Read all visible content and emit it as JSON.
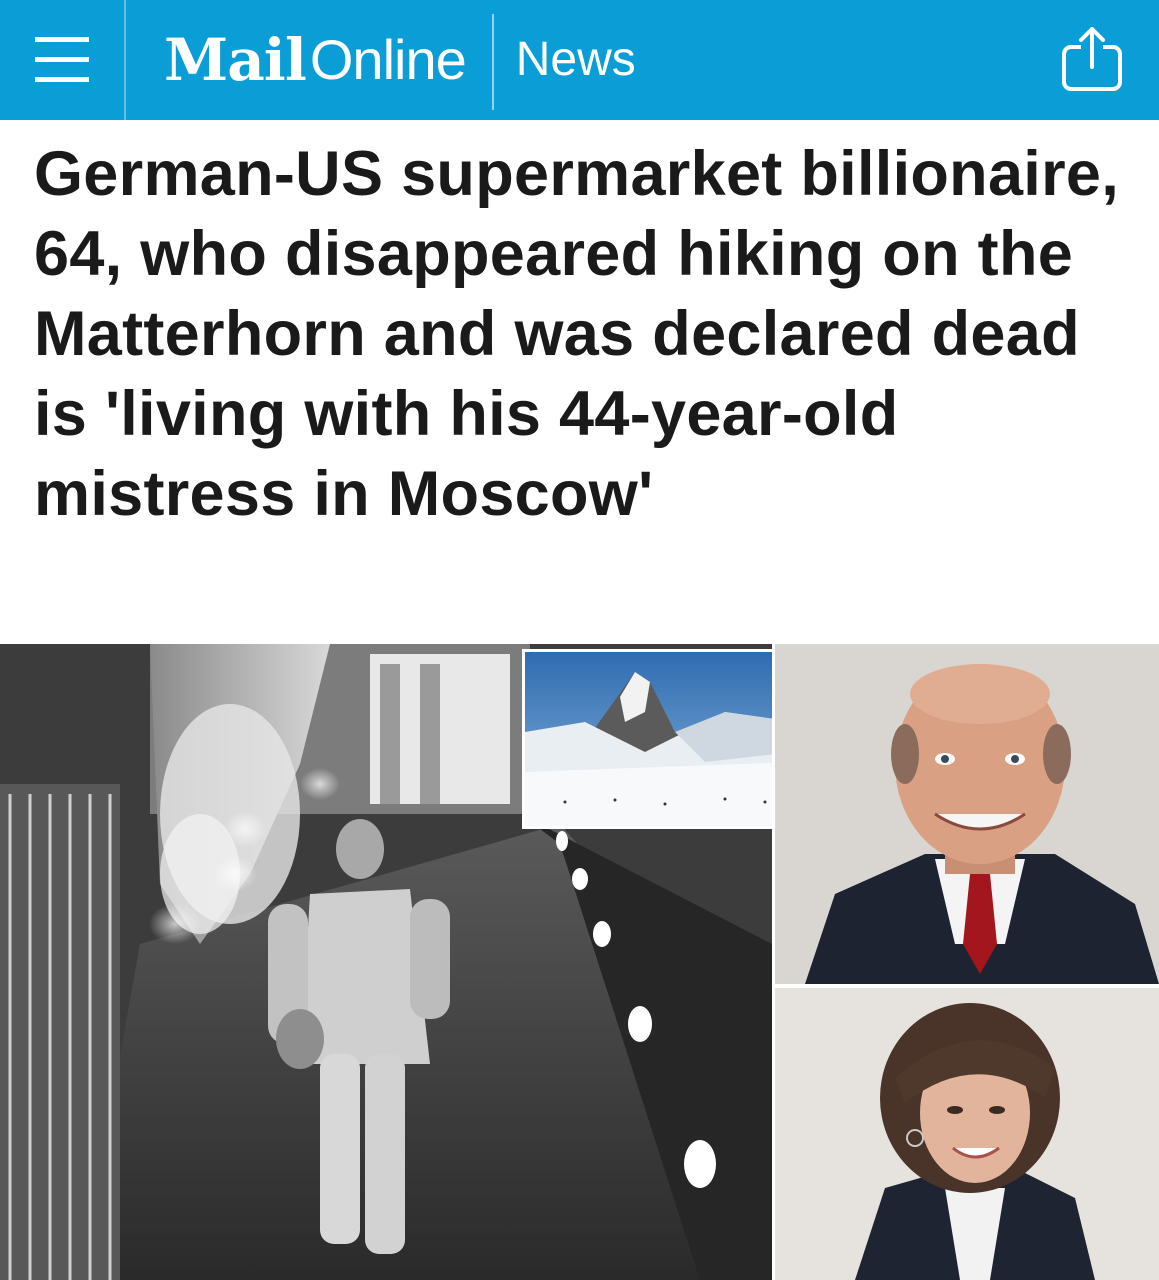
{
  "header": {
    "brand_primary": "Mail",
    "brand_secondary": "Online",
    "section_label": "News",
    "accent_color": "#0b9ed6",
    "menu_icon": "hamburger-menu-icon",
    "share_icon": "share-icon"
  },
  "article": {
    "headline": "German-US supermarket billionaire, 64, who disappeared hiking on the Matterhorn and was declared dead is 'living with his 44-year-old mistress in Moscow'"
  },
  "images": [
    {
      "name": "cctv-still",
      "kind": "security camera still of man in corridor"
    },
    {
      "name": "matterhorn-photo",
      "kind": "snowy mountain landscape"
    },
    {
      "name": "man-portrait",
      "kind": "portrait of man in suit with red tie"
    },
    {
      "name": "woman-portrait",
      "kind": "portrait of woman with dark hair"
    }
  ]
}
